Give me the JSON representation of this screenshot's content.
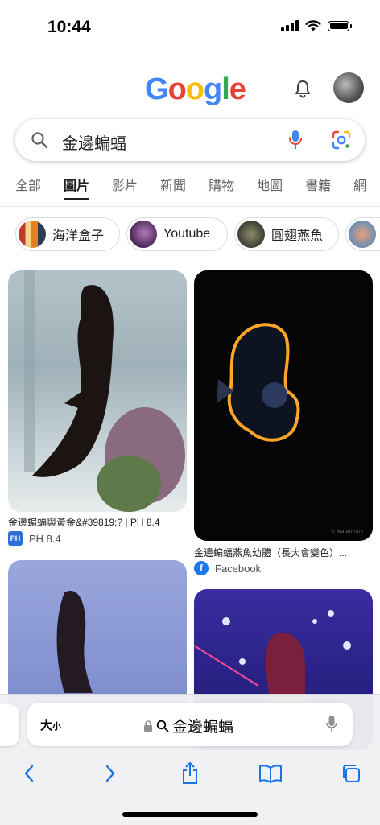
{
  "status_bar": {
    "time": "10:44"
  },
  "header": {
    "logo_letters": [
      {
        "char": "G",
        "color": "#4285F4"
      },
      {
        "char": "o",
        "color": "#EA4335"
      },
      {
        "char": "o",
        "color": "#FBBC05"
      },
      {
        "char": "g",
        "color": "#4285F4"
      },
      {
        "char": "l",
        "color": "#34A853"
      },
      {
        "char": "e",
        "color": "#EA4335"
      }
    ],
    "notifications_icon": "bell-icon",
    "account_icon": "avatar"
  },
  "search": {
    "query": "金邊蝙蝠"
  },
  "tabs": [
    {
      "label": "全部",
      "active": false
    },
    {
      "label": "圖片",
      "active": true
    },
    {
      "label": "影片",
      "active": false
    },
    {
      "label": "新聞",
      "active": false
    },
    {
      "label": "購物",
      "active": false
    },
    {
      "label": "地圖",
      "active": false
    },
    {
      "label": "書籍",
      "active": false
    },
    {
      "label": "網",
      "active": false
    }
  ],
  "chips": [
    {
      "label": "海洋盒子"
    },
    {
      "label": "Youtube"
    },
    {
      "label": "圓翅燕魚"
    },
    {
      "label": ""
    }
  ],
  "results": [
    {
      "caption": "金邊蝙蝠與黃金&#39819;? | PH 8.4",
      "source": "PH 8.4"
    },
    {
      "caption": "金邊蝙蝠燕魚幼體（長大會變色）...",
      "source": "Facebook"
    },
    {
      "caption": "",
      "source": ""
    },
    {
      "caption": "",
      "source": ""
    }
  ],
  "safari": {
    "text_size_big": "大",
    "text_size_small": "小",
    "url": "金邊蝙蝠",
    "toolbar_icons": [
      "back-icon",
      "forward-icon",
      "share-icon",
      "bookmarks-icon",
      "tabs-icon"
    ]
  },
  "colors": {
    "accent": "#1a73e8",
    "safari_blue": "#1877f2"
  }
}
